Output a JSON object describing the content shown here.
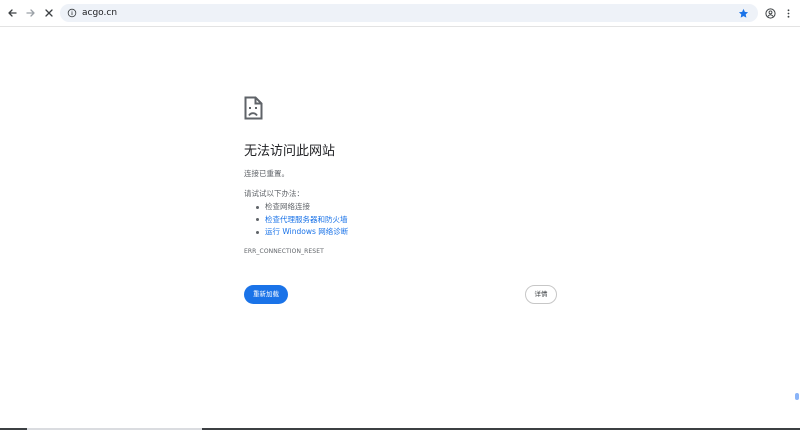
{
  "toolbar": {
    "url": "acgo.cn",
    "icons": {
      "back": "back-arrow-icon",
      "forward": "forward-arrow-icon",
      "stop": "close-icon",
      "info": "info-icon",
      "bookmark": "star-icon",
      "profile": "profile-icon",
      "menu": "more-vert-icon"
    }
  },
  "error": {
    "title": "无法访问此网站",
    "subtitle": "连接已重置。",
    "try_label": "请试试以下办法：",
    "suggestions": [
      {
        "label": "检查网络连接",
        "is_link": false
      },
      {
        "label": "检查代理服务器和防火墙",
        "is_link": true
      },
      {
        "label": "运行 Windows 网络诊断",
        "is_link": true
      }
    ],
    "code": "ERR_CONNECTION_RESET",
    "reload_label": "重新加载",
    "details_label": "详情"
  },
  "colors": {
    "accent": "#1a73e8",
    "text": "#202124",
    "secondary_text": "#5f6368",
    "omnibox_bg": "#eef2f8"
  }
}
